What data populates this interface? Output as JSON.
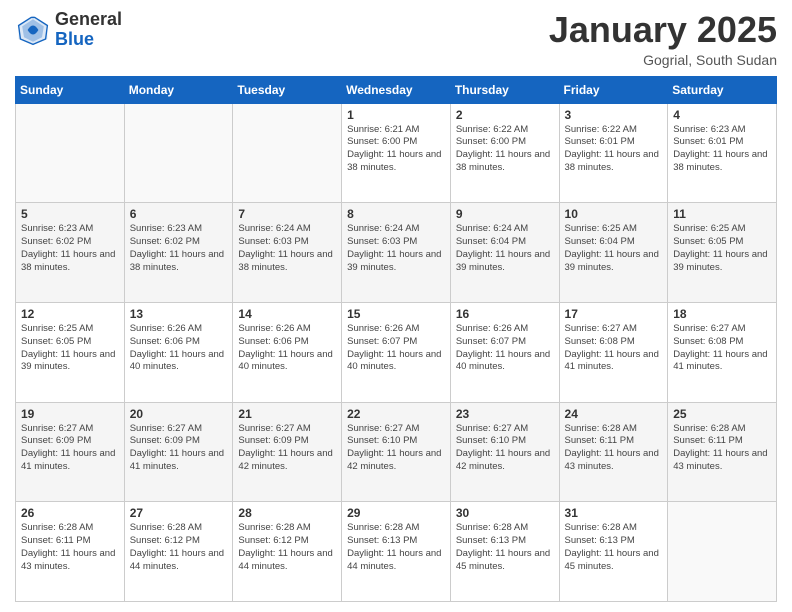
{
  "header": {
    "logo": {
      "general": "General",
      "blue": "Blue"
    },
    "title": "January 2025",
    "location": "Gogrial, South Sudan"
  },
  "weekdays": [
    "Sunday",
    "Monday",
    "Tuesday",
    "Wednesday",
    "Thursday",
    "Friday",
    "Saturday"
  ],
  "weeks": [
    [
      {
        "day": "",
        "sunrise": "",
        "sunset": "",
        "daylight": ""
      },
      {
        "day": "",
        "sunrise": "",
        "sunset": "",
        "daylight": ""
      },
      {
        "day": "",
        "sunrise": "",
        "sunset": "",
        "daylight": ""
      },
      {
        "day": "1",
        "sunrise": "Sunrise: 6:21 AM",
        "sunset": "Sunset: 6:00 PM",
        "daylight": "Daylight: 11 hours and 38 minutes."
      },
      {
        "day": "2",
        "sunrise": "Sunrise: 6:22 AM",
        "sunset": "Sunset: 6:00 PM",
        "daylight": "Daylight: 11 hours and 38 minutes."
      },
      {
        "day": "3",
        "sunrise": "Sunrise: 6:22 AM",
        "sunset": "Sunset: 6:01 PM",
        "daylight": "Daylight: 11 hours and 38 minutes."
      },
      {
        "day": "4",
        "sunrise": "Sunrise: 6:23 AM",
        "sunset": "Sunset: 6:01 PM",
        "daylight": "Daylight: 11 hours and 38 minutes."
      }
    ],
    [
      {
        "day": "5",
        "sunrise": "Sunrise: 6:23 AM",
        "sunset": "Sunset: 6:02 PM",
        "daylight": "Daylight: 11 hours and 38 minutes."
      },
      {
        "day": "6",
        "sunrise": "Sunrise: 6:23 AM",
        "sunset": "Sunset: 6:02 PM",
        "daylight": "Daylight: 11 hours and 38 minutes."
      },
      {
        "day": "7",
        "sunrise": "Sunrise: 6:24 AM",
        "sunset": "Sunset: 6:03 PM",
        "daylight": "Daylight: 11 hours and 38 minutes."
      },
      {
        "day": "8",
        "sunrise": "Sunrise: 6:24 AM",
        "sunset": "Sunset: 6:03 PM",
        "daylight": "Daylight: 11 hours and 39 minutes."
      },
      {
        "day": "9",
        "sunrise": "Sunrise: 6:24 AM",
        "sunset": "Sunset: 6:04 PM",
        "daylight": "Daylight: 11 hours and 39 minutes."
      },
      {
        "day": "10",
        "sunrise": "Sunrise: 6:25 AM",
        "sunset": "Sunset: 6:04 PM",
        "daylight": "Daylight: 11 hours and 39 minutes."
      },
      {
        "day": "11",
        "sunrise": "Sunrise: 6:25 AM",
        "sunset": "Sunset: 6:05 PM",
        "daylight": "Daylight: 11 hours and 39 minutes."
      }
    ],
    [
      {
        "day": "12",
        "sunrise": "Sunrise: 6:25 AM",
        "sunset": "Sunset: 6:05 PM",
        "daylight": "Daylight: 11 hours and 39 minutes."
      },
      {
        "day": "13",
        "sunrise": "Sunrise: 6:26 AM",
        "sunset": "Sunset: 6:06 PM",
        "daylight": "Daylight: 11 hours and 40 minutes."
      },
      {
        "day": "14",
        "sunrise": "Sunrise: 6:26 AM",
        "sunset": "Sunset: 6:06 PM",
        "daylight": "Daylight: 11 hours and 40 minutes."
      },
      {
        "day": "15",
        "sunrise": "Sunrise: 6:26 AM",
        "sunset": "Sunset: 6:07 PM",
        "daylight": "Daylight: 11 hours and 40 minutes."
      },
      {
        "day": "16",
        "sunrise": "Sunrise: 6:26 AM",
        "sunset": "Sunset: 6:07 PM",
        "daylight": "Daylight: 11 hours and 40 minutes."
      },
      {
        "day": "17",
        "sunrise": "Sunrise: 6:27 AM",
        "sunset": "Sunset: 6:08 PM",
        "daylight": "Daylight: 11 hours and 41 minutes."
      },
      {
        "day": "18",
        "sunrise": "Sunrise: 6:27 AM",
        "sunset": "Sunset: 6:08 PM",
        "daylight": "Daylight: 11 hours and 41 minutes."
      }
    ],
    [
      {
        "day": "19",
        "sunrise": "Sunrise: 6:27 AM",
        "sunset": "Sunset: 6:09 PM",
        "daylight": "Daylight: 11 hours and 41 minutes."
      },
      {
        "day": "20",
        "sunrise": "Sunrise: 6:27 AM",
        "sunset": "Sunset: 6:09 PM",
        "daylight": "Daylight: 11 hours and 41 minutes."
      },
      {
        "day": "21",
        "sunrise": "Sunrise: 6:27 AM",
        "sunset": "Sunset: 6:09 PM",
        "daylight": "Daylight: 11 hours and 42 minutes."
      },
      {
        "day": "22",
        "sunrise": "Sunrise: 6:27 AM",
        "sunset": "Sunset: 6:10 PM",
        "daylight": "Daylight: 11 hours and 42 minutes."
      },
      {
        "day": "23",
        "sunrise": "Sunrise: 6:27 AM",
        "sunset": "Sunset: 6:10 PM",
        "daylight": "Daylight: 11 hours and 42 minutes."
      },
      {
        "day": "24",
        "sunrise": "Sunrise: 6:28 AM",
        "sunset": "Sunset: 6:11 PM",
        "daylight": "Daylight: 11 hours and 43 minutes."
      },
      {
        "day": "25",
        "sunrise": "Sunrise: 6:28 AM",
        "sunset": "Sunset: 6:11 PM",
        "daylight": "Daylight: 11 hours and 43 minutes."
      }
    ],
    [
      {
        "day": "26",
        "sunrise": "Sunrise: 6:28 AM",
        "sunset": "Sunset: 6:11 PM",
        "daylight": "Daylight: 11 hours and 43 minutes."
      },
      {
        "day": "27",
        "sunrise": "Sunrise: 6:28 AM",
        "sunset": "Sunset: 6:12 PM",
        "daylight": "Daylight: 11 hours and 44 minutes."
      },
      {
        "day": "28",
        "sunrise": "Sunrise: 6:28 AM",
        "sunset": "Sunset: 6:12 PM",
        "daylight": "Daylight: 11 hours and 44 minutes."
      },
      {
        "day": "29",
        "sunrise": "Sunrise: 6:28 AM",
        "sunset": "Sunset: 6:13 PM",
        "daylight": "Daylight: 11 hours and 44 minutes."
      },
      {
        "day": "30",
        "sunrise": "Sunrise: 6:28 AM",
        "sunset": "Sunset: 6:13 PM",
        "daylight": "Daylight: 11 hours and 45 minutes."
      },
      {
        "day": "31",
        "sunrise": "Sunrise: 6:28 AM",
        "sunset": "Sunset: 6:13 PM",
        "daylight": "Daylight: 11 hours and 45 minutes."
      },
      {
        "day": "",
        "sunrise": "",
        "sunset": "",
        "daylight": ""
      }
    ]
  ]
}
